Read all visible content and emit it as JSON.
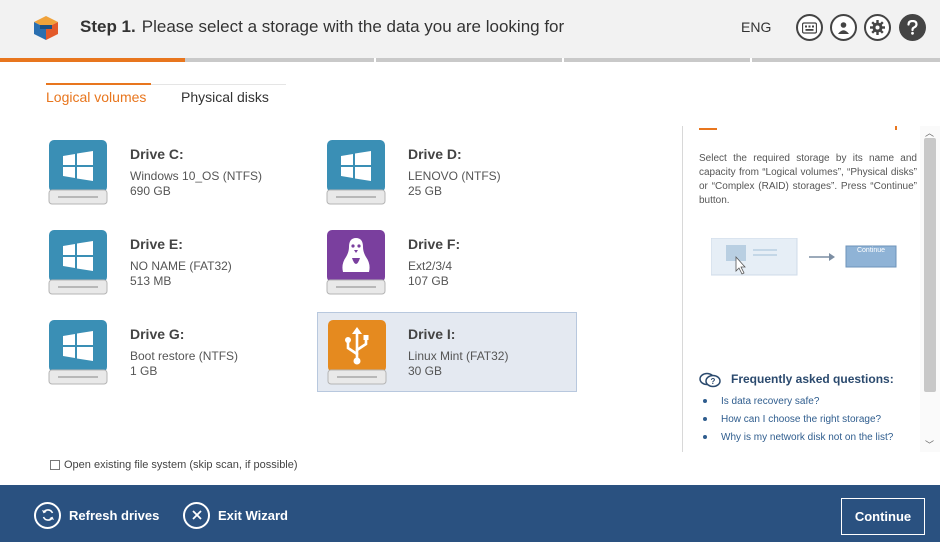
{
  "header": {
    "step_label": "Step 1.",
    "title": "Please select a storage with the data you are looking for",
    "language": "ENG",
    "icons": [
      "keyboard-icon",
      "user-icon",
      "gear-icon",
      "help-icon"
    ]
  },
  "tabs": [
    {
      "label": "Logical volumes",
      "active": true
    },
    {
      "label": "Physical disks",
      "active": false
    }
  ],
  "drives": [
    {
      "name": "Drive C:",
      "fs": "Windows 10_OS (NTFS)",
      "size": "690 GB",
      "os": "windows",
      "selected": false
    },
    {
      "name": "Drive D:",
      "fs": "LENOVO (NTFS)",
      "size": "25 GB",
      "os": "windows",
      "selected": false
    },
    {
      "name": "Drive E:",
      "fs": "NO NAME (FAT32)",
      "size": "513 MB",
      "os": "windows",
      "selected": false
    },
    {
      "name": "Drive F:",
      "fs": "Ext2/3/4",
      "size": "107 GB",
      "os": "linux",
      "selected": false
    },
    {
      "name": "Drive G:",
      "fs": "Boot restore (NTFS)",
      "size": "1 GB",
      "os": "windows",
      "selected": false
    },
    {
      "name": "Drive I:",
      "fs": "Linux Mint (FAT32)",
      "size": "30 GB",
      "os": "usb",
      "selected": true
    }
  ],
  "side_panel": {
    "help_text": "Select the required storage by its name and capacity from “Logical volumes”, “Physical disks” or “Complex (RAID) storages”. Press “Continue” button.",
    "illustration_button": "Continue",
    "faq_title": "Frequently asked questions:",
    "faq": [
      "Is data recovery safe?",
      "How can I choose the right storage?",
      "Why is my network disk not on the list?"
    ]
  },
  "checkbox": {
    "label": "Open existing file system (skip scan, if possible)",
    "checked": false
  },
  "footer": {
    "refresh_label": "Refresh drives",
    "exit_label": "Exit Wizard",
    "continue_label": "Continue"
  },
  "colors": {
    "accent": "#e8761e",
    "footer_bg": "#2a5180",
    "windows_drive": "#3a8fb5",
    "linux_drive": "#7a3f9e",
    "usb_drive": "#e58a1f",
    "link": "#2f5d8e"
  }
}
